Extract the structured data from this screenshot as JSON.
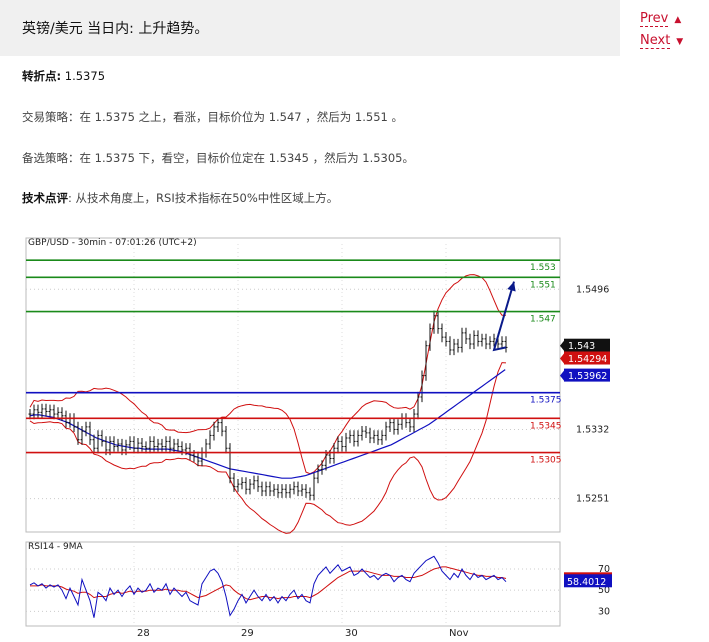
{
  "header": {
    "title": "英镑/美元 当日内: 上升趋势。",
    "prev_label": "Prev",
    "next_label": "Next"
  },
  "commentary": {
    "pivot_label": "转折点:",
    "pivot_value": "1.5375",
    "strategy_label": "交易策略：",
    "strategy_text": "在 1.5375 之上，看涨，目标价位为 1.547 ，然后为 1.551 。",
    "alt_label": "备选策略：",
    "alt_text": "在 1.5375 下，看空，目标价位定在 1.5345 ，然后为 1.5305。",
    "tech_label": "技术点评",
    "tech_text": ": 从技术角度上，RSI技术指标在50%中性区域上方。"
  },
  "chart_data": {
    "type": "line",
    "title": "GBP/USD - 30min - 07:01:26 (UTC+2)",
    "price_axis": {
      "ylim": [
        1.5212,
        1.5549
      ],
      "ticks": [
        1.5496,
        1.5332,
        1.5251
      ],
      "current_price": "1.543",
      "lower_band_label": "1.54294",
      "ma_label": "1.53962"
    },
    "x_ticks": [
      {
        "label": "28",
        "bar": 26
      },
      {
        "label": "29",
        "bar": 52
      },
      {
        "label": "30",
        "bar": 78
      },
      {
        "label": "Nov",
        "bar": 104
      }
    ],
    "levels": [
      {
        "value": 1.553,
        "label": "1.553",
        "color": "#1a8a1a",
        "kind": "resistance"
      },
      {
        "value": 1.551,
        "label": "1.551",
        "color": "#1a8a1a",
        "kind": "resistance"
      },
      {
        "value": 1.547,
        "label": "1.547",
        "color": "#1a8a1a",
        "kind": "resistance"
      },
      {
        "value": 1.5375,
        "label": "1.5375",
        "color": "#1010c0",
        "kind": "pivot"
      },
      {
        "value": 1.5345,
        "label": "1.5345",
        "color": "#d01010",
        "kind": "support"
      },
      {
        "value": 1.5305,
        "label": "1.5305",
        "color": "#d01010",
        "kind": "support"
      }
    ],
    "close": [
      1.535,
      1.5355,
      1.5352,
      1.5356,
      1.5353,
      1.5355,
      1.535,
      1.5352,
      1.5348,
      1.534,
      1.5345,
      1.5335,
      1.532,
      1.533,
      1.5335,
      1.532,
      1.531,
      1.5325,
      1.5318,
      1.5308,
      1.5318,
      1.5312,
      1.5315,
      1.5308,
      1.5314,
      1.5318,
      1.531,
      1.5316,
      1.5312,
      1.531,
      1.5318,
      1.5312,
      1.5315,
      1.5312,
      1.5318,
      1.531,
      1.5315,
      1.5312,
      1.5308,
      1.531,
      1.5302,
      1.53,
      1.5295,
      1.5305,
      1.5315,
      1.5325,
      1.5335,
      1.534,
      1.533,
      1.531,
      1.5275,
      1.5265,
      1.5268,
      1.527,
      1.5262,
      1.5268,
      1.5272,
      1.5265,
      1.526,
      1.5265,
      1.526,
      1.5262,
      1.5258,
      1.5262,
      1.5258,
      1.5262,
      1.5265,
      1.526,
      1.5262,
      1.5258,
      1.5255,
      1.5275,
      1.5285,
      1.529,
      1.5302,
      1.5298,
      1.531,
      1.5318,
      1.5312,
      1.5322,
      1.5325,
      1.5318,
      1.5325,
      1.533,
      1.5328,
      1.5322,
      1.5325,
      1.532,
      1.5325,
      1.5335,
      1.534,
      1.5332,
      1.5338,
      1.5345,
      1.534,
      1.5335,
      1.535,
      1.537,
      1.5395,
      1.543,
      1.545,
      1.5465,
      1.545,
      1.544,
      1.5435,
      1.5425,
      1.5432,
      1.5428,
      1.5445,
      1.5438,
      1.5432,
      1.5442,
      1.5435,
      1.5438,
      1.5432,
      1.5435,
      1.5438,
      1.5432,
      1.5435,
      1.5428
    ],
    "ma": [
      1.5348,
      1.5349,
      1.5349,
      1.5348,
      1.5347,
      1.5346,
      1.5344,
      1.5342,
      1.534,
      1.5337,
      1.5334,
      1.5331,
      1.5328,
      1.5325,
      1.5322,
      1.532,
      1.5318,
      1.5316,
      1.5314,
      1.5313,
      1.5312,
      1.5311,
      1.531,
      1.531,
      1.5309,
      1.5309,
      1.5309,
      1.5309,
      1.5309,
      1.5309,
      1.5308,
      1.5307,
      1.5306,
      1.5304,
      1.5302,
      1.53,
      1.5298,
      1.5296,
      1.5294,
      1.5292,
      1.529,
      1.5288,
      1.5286,
      1.5285,
      1.5284,
      1.5283,
      1.5282,
      1.5281,
      1.528,
      1.5279,
      1.5278,
      1.5277,
      1.5276,
      1.5275,
      1.5275,
      1.5275,
      1.5276,
      1.5277,
      1.5278,
      1.528,
      1.5282,
      1.5284,
      1.5286,
      1.5288,
      1.529,
      1.5292,
      1.5294,
      1.5296,
      1.5298,
      1.53,
      1.5302,
      1.5304,
      1.5306,
      1.5308,
      1.531,
      1.5312,
      1.5314,
      1.5317,
      1.532,
      1.5323,
      1.5326,
      1.5329,
      1.5332,
      1.5335,
      1.5338,
      1.5342,
      1.5346,
      1.535,
      1.5354,
      1.5358,
      1.5362,
      1.5366,
      1.537,
      1.5374,
      1.5378,
      1.5382,
      1.5386,
      1.539,
      1.5394,
      1.5398,
      1.5402
    ],
    "projection": [
      {
        "bar": 116,
        "value": 1.5425
      },
      {
        "bar": 121,
        "value": 1.5505
      }
    ],
    "rsi": {
      "label": "RSI14 - 9MA",
      "ylim": [
        18,
        88
      ],
      "ticks": [
        70,
        50,
        30
      ],
      "rsi_value": "58.4012",
      "ma_value": "60.2825",
      "rsi": [
        55,
        57,
        54,
        56,
        52,
        55,
        53,
        55,
        50,
        42,
        52,
        44,
        36,
        60,
        50,
        40,
        24,
        48,
        45,
        40,
        52,
        46,
        50,
        44,
        50,
        54,
        46,
        52,
        48,
        50,
        56,
        48,
        52,
        50,
        56,
        46,
        52,
        48,
        44,
        48,
        40,
        38,
        36,
        56,
        62,
        68,
        70,
        66,
        58,
        44,
        26,
        32,
        40,
        46,
        38,
        44,
        50,
        44,
        40,
        46,
        40,
        44,
        38,
        44,
        40,
        46,
        50,
        42,
        46,
        40,
        38,
        56,
        64,
        68,
        72,
        66,
        70,
        74,
        68,
        70,
        72,
        64,
        66,
        70,
        66,
        62,
        64,
        60,
        64,
        66,
        64,
        58,
        62,
        64,
        60,
        58,
        66,
        70,
        74,
        78,
        80,
        82,
        76,
        68,
        64,
        60,
        66,
        62,
        70,
        64,
        60,
        66,
        62,
        64,
        60,
        62,
        64,
        60,
        62,
        58
      ],
      "ma": [
        54,
        54,
        54,
        55,
        54,
        54,
        54,
        54,
        53,
        51,
        50,
        49,
        47,
        48,
        48,
        46,
        43,
        44,
        44,
        44,
        46,
        47,
        48,
        47,
        48,
        49,
        48,
        49,
        49,
        49,
        50,
        50,
        50,
        50,
        51,
        50,
        50,
        50,
        49,
        49,
        47,
        45,
        43,
        44,
        45,
        47,
        49,
        51,
        53,
        55,
        54,
        50,
        47,
        45,
        42,
        41,
        42,
        43,
        44,
        44,
        43,
        43,
        42,
        43,
        43,
        43,
        44,
        44,
        44,
        44,
        43,
        45,
        47,
        50,
        53,
        56,
        59,
        62,
        64,
        66,
        68,
        68,
        68,
        68,
        68,
        67,
        66,
        65,
        64,
        64,
        64,
        63,
        63,
        63,
        62,
        62,
        62,
        63,
        64,
        66,
        68,
        70,
        71,
        72,
        72,
        71,
        70,
        69,
        68,
        67,
        66,
        65,
        64,
        64,
        63,
        63,
        63,
        62,
        62,
        61
      ]
    }
  }
}
